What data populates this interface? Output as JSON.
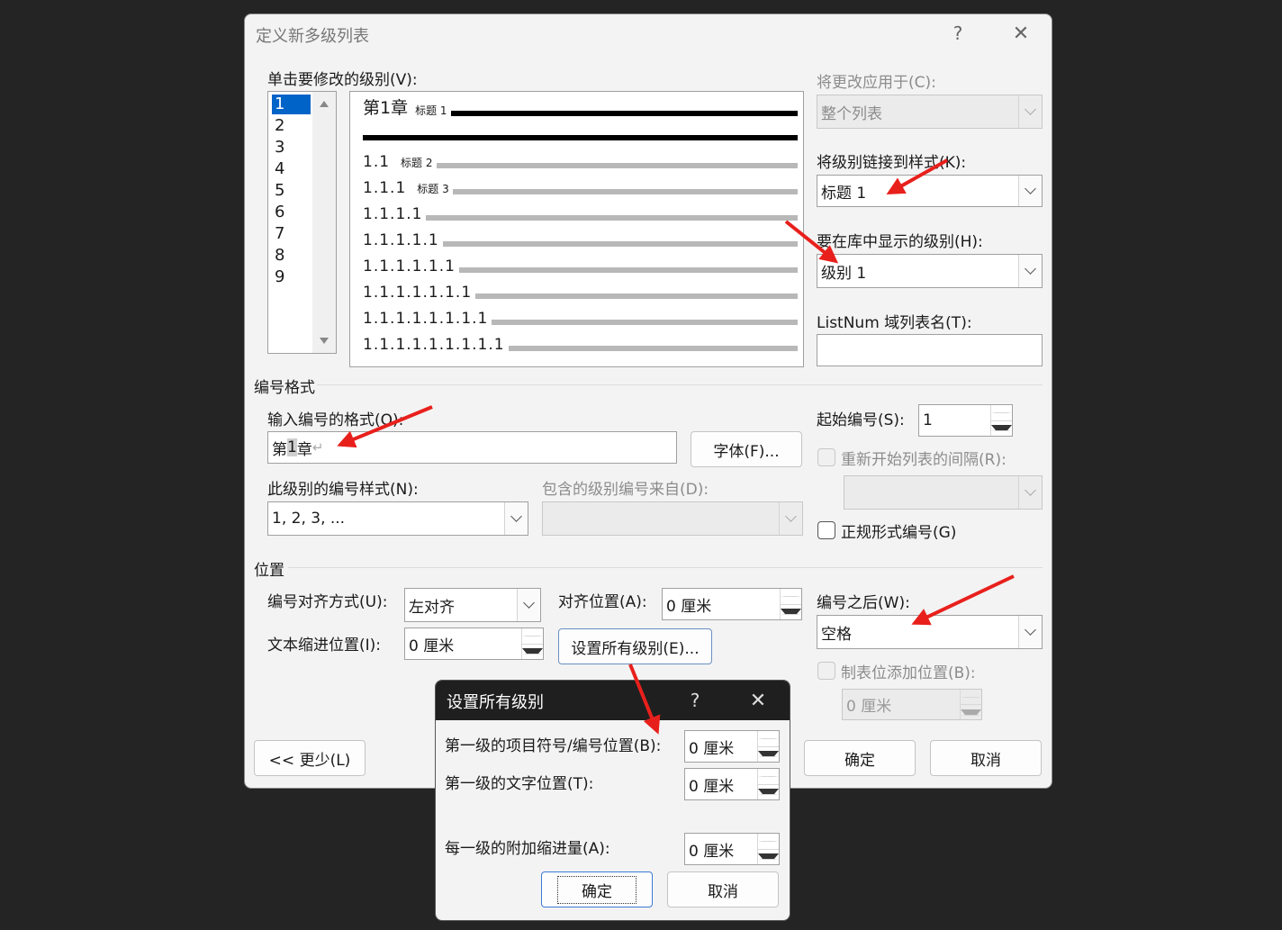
{
  "dialog": {
    "title": "定义新多级列表",
    "help": "?",
    "close": "✕",
    "click_level_label": "单击要修改的级别(V):",
    "levels": [
      "1",
      "2",
      "3",
      "4",
      "5",
      "6",
      "7",
      "8",
      "9"
    ],
    "preview": {
      "rows": [
        {
          "num": "第1章",
          "style": "标题 1"
        },
        {
          "num": "1.1",
          "style": "标题 2"
        },
        {
          "num": "1.1.1",
          "style": "标题 3"
        },
        {
          "num": "1.1.1.1",
          "style": ""
        },
        {
          "num": "1.1.1.1.1",
          "style": ""
        },
        {
          "num": "1.1.1.1.1.1",
          "style": ""
        },
        {
          "num": "1.1.1.1.1.1.1",
          "style": ""
        },
        {
          "num": "1.1.1.1.1.1.1.1",
          "style": ""
        },
        {
          "num": "1.1.1.1.1.1.1.1.1",
          "style": ""
        }
      ]
    },
    "apply_to_label": "将更改应用于(C):",
    "apply_to_value": "整个列表",
    "link_style_label": "将级别链接到样式(K):",
    "link_style_value": "标题 1",
    "gallery_level_label": "要在库中显示的级别(H):",
    "gallery_level_value": "级别 1",
    "listnum_label": "ListNum 域列表名(T):",
    "listnum_value": "",
    "number_format_section": "编号格式",
    "enter_format_label": "输入编号的格式(O):",
    "format_prefix": "第",
    "format_field": "1",
    "format_suffix": "章",
    "format_mark": "↵",
    "font_button": "字体(F)...",
    "start_at_label": "起始编号(S):",
    "start_at_value": "1",
    "restart_label": "重新开始列表的间隔(R):",
    "restart_value": "",
    "number_style_label": "此级别的编号样式(N):",
    "number_style_value": "1, 2, 3, ...",
    "include_level_label": "包含的级别编号来自(D):",
    "include_level_value": "",
    "legal_label": "正规形式编号(G)",
    "position_section": "位置",
    "alignment_label": "编号对齐方式(U):",
    "alignment_value": "左对齐",
    "aligned_at_label": "对齐位置(A):",
    "aligned_at_value": "0 厘米",
    "text_indent_label": "文本缩进位置(I):",
    "text_indent_value": "0 厘米",
    "set_all_button": "设置所有级别(E)...",
    "follow_label": "编号之后(W):",
    "follow_value": "空格",
    "tab_stop_label": "制表位添加位置(B):",
    "tab_stop_value": "0 厘米",
    "less_button": "<< 更少(L)",
    "ok_button": "确定",
    "cancel_button": "取消"
  },
  "set_all_dialog": {
    "title": "设置所有级别",
    "help": "?",
    "close": "✕",
    "bullet_position_label": "第一级的项目符号/编号位置(B):",
    "bullet_position_value": "0 厘米",
    "text_position_label": "第一级的文字位置(T):",
    "text_position_value": "0 厘米",
    "additional_indent_label": "每一级的附加缩进量(A):",
    "additional_indent_value": "0 厘米",
    "ok_button": "确定",
    "cancel_button": "取消"
  },
  "colors": {
    "annotation_arrow": "#e8201c",
    "selection": "#0063c8"
  }
}
